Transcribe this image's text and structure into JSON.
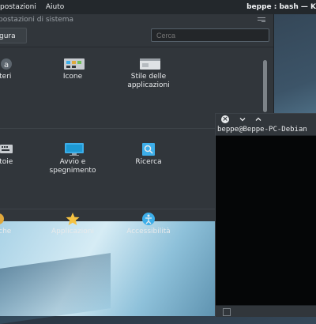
{
  "panel": {
    "menu": [
      "postazioni",
      "Aiuto"
    ],
    "window_title": "beppe : bash — K"
  },
  "settings": {
    "title": "postazioni di sistema",
    "configure_label": "gura",
    "search_placeholder": "Cerca",
    "row1": [
      {
        "label": "tteri",
        "icon": "characters-icon"
      },
      {
        "label": "Icone",
        "icon": "icons-icon"
      },
      {
        "label": "Stile delle applicazioni",
        "icon": "app-style-icon"
      }
    ],
    "row2": [
      {
        "label": "atoie",
        "icon": "keyboard-icon"
      },
      {
        "label": "Avvio e spegnimento",
        "icon": "startup-shutdown-icon"
      },
      {
        "label": "Ricerca",
        "icon": "search-icon"
      }
    ],
    "row3": [
      {
        "label": "iche",
        "icon": "partial-icon"
      },
      {
        "label": "Applicazioni",
        "icon": "star-icon"
      },
      {
        "label": "Accessibilità",
        "icon": "accessibility-icon"
      }
    ]
  },
  "terminal": {
    "prompt": "beppe@Beppe-PC-Debian"
  },
  "colors": {
    "panel_bg": "#23282c",
    "window_bg": "#31363b",
    "accent_blue": "#3daee9",
    "star_gold": "#f5c242"
  }
}
